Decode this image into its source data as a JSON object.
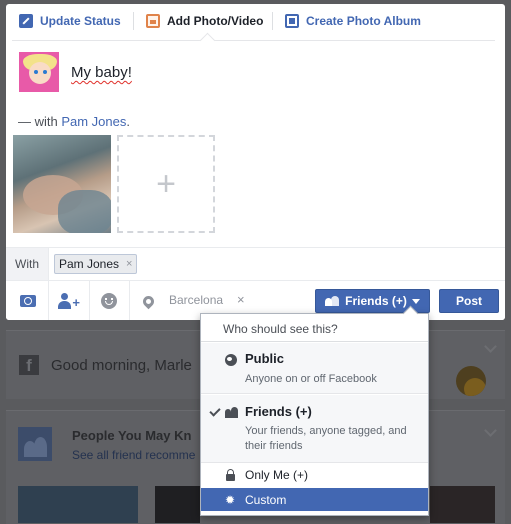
{
  "composer": {
    "tabs": [
      {
        "label": "Update Status",
        "icon": "pencil-icon"
      },
      {
        "label": "Add Photo/Video",
        "icon": "photo-icon"
      },
      {
        "label": "Create Photo Album",
        "icon": "album-icon"
      }
    ],
    "post_text": "My baby!",
    "with_prefix": "— with ",
    "tagged_person": "Pam Jones",
    "with_suffix": ".",
    "add_photo_glyph": "+",
    "with_label": "With",
    "tag_chip": {
      "name": "Pam Jones",
      "remove": "×"
    },
    "location": {
      "value": "Barcelona",
      "remove": "×"
    },
    "audience_button": "Friends (+)",
    "post_button": "Post"
  },
  "audience_menu": {
    "header": "Who should see this?",
    "options": [
      {
        "title": "Public",
        "description": "Anyone on or off Facebook",
        "icon": "globe-icon",
        "checked": false
      },
      {
        "title": "Friends (+)",
        "description": "Your friends, anyone tagged, and their friends",
        "icon": "friends-icon",
        "checked": true
      },
      {
        "title": "Only Me (+)",
        "icon": "lock-icon",
        "checked": false
      },
      {
        "title": "Custom",
        "icon": "gear-icon",
        "checked": false,
        "highlighted": true
      }
    ]
  },
  "background_feed": {
    "greeting": "Good morning, Marle",
    "pymk_title": "People You May Kn",
    "pymk_link": "See all friend recomme"
  },
  "colors": {
    "brand": "#4267b2",
    "link": "#4267b2",
    "overlay": "#5a5b5e"
  }
}
